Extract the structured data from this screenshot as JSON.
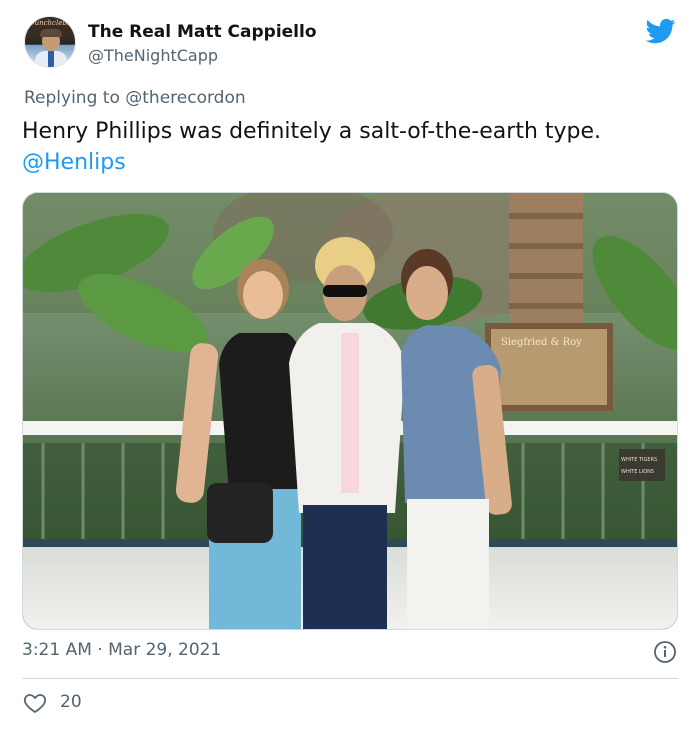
{
  "author": {
    "display_name": "The Real Matt Cappiello",
    "handle": "@TheNightCapp",
    "avatar_text": "Dunchcleba"
  },
  "reply": {
    "prefix": "Replying to",
    "mention": "@therecordon"
  },
  "tweet": {
    "text": "Henry Phillips was definitely a salt-of-the-earth type.",
    "mention": "@Henlips"
  },
  "photo": {
    "plaque_text": "Siegfried & Roy",
    "sign_lines": [
      "WHITE TIGERS",
      "WHITE LIONS"
    ]
  },
  "meta": {
    "time": "3:21 AM",
    "separator": " · ",
    "date": "Mar 29, 2021"
  },
  "likes": {
    "count": "20"
  },
  "colors": {
    "twitter_blue": "#1d9bf0",
    "secondary_text": "#536471",
    "border": "#cfd9de"
  },
  "icons": [
    "twitter-bird-icon",
    "info-icon",
    "heart-icon"
  ]
}
